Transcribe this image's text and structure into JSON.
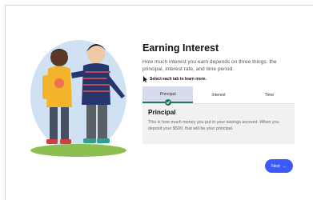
{
  "lesson": {
    "title": "Earning Interest",
    "intro": "How much interest you earn depends on three things: the principal, interest rate, and time period.",
    "instruction": "Select each tab to learn more."
  },
  "tabs": [
    {
      "label": "Principal",
      "active": true
    },
    {
      "label": "Interest",
      "active": false
    },
    {
      "label": "Time",
      "active": false
    }
  ],
  "panel": {
    "title": "Principal",
    "text": "This is how much money you put in your savings account. When you deposit your $500, that will be your principal."
  },
  "navigation": {
    "next_label": "Next",
    "next_icon": "arrow-right-icon"
  },
  "icons": {
    "pointer": "mouse-pointer-icon",
    "check": "check-circle-icon"
  },
  "colors": {
    "accent": "#3c5bff",
    "tab_active": "#d7dcec",
    "success": "#1f7a5c",
    "panel_bg": "#f1f1f1"
  }
}
